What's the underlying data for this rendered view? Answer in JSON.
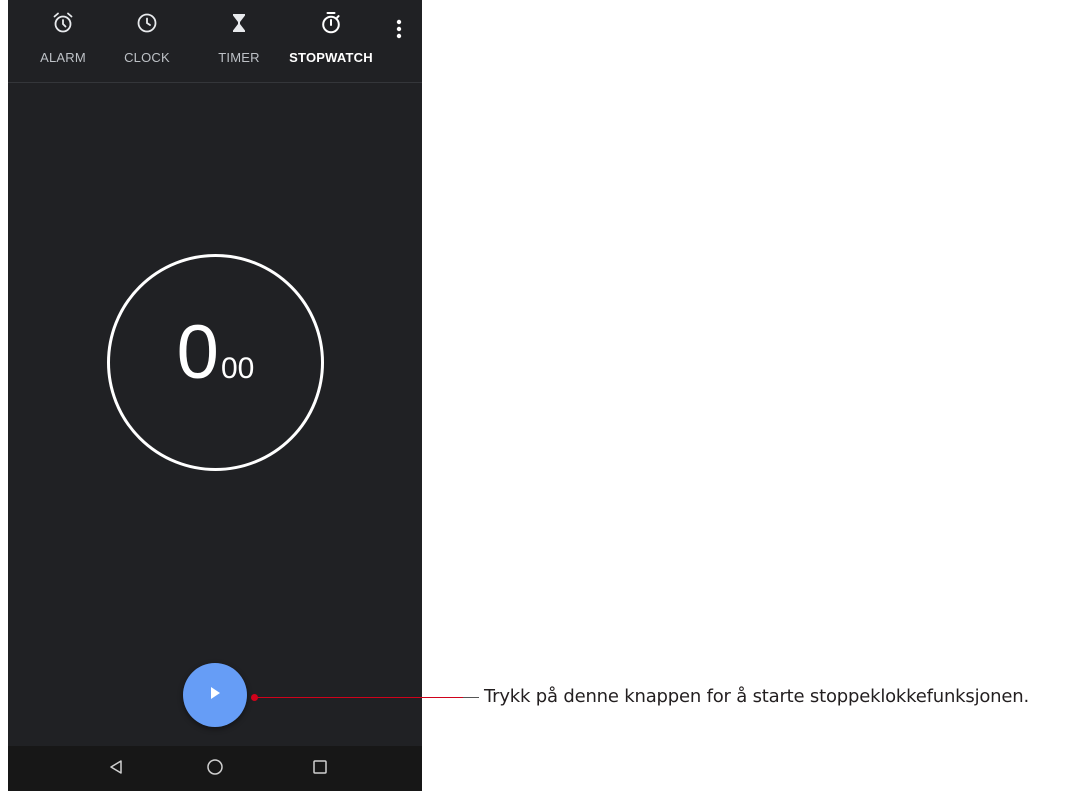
{
  "tabs": [
    {
      "label": "ALARM",
      "icon": "alarm-clock-icon",
      "active": false
    },
    {
      "label": "CLOCK",
      "icon": "clock-icon",
      "active": false
    },
    {
      "label": "TIMER",
      "icon": "hourglass-icon",
      "active": false
    },
    {
      "label": "STOPWATCH",
      "icon": "stopwatch-icon",
      "active": true
    }
  ],
  "overflow_menu": {
    "icon": "more-vertical-icon"
  },
  "stopwatch": {
    "seconds": "0",
    "hundredths": "00"
  },
  "play_button": {
    "icon": "play-icon",
    "color": "#669df6"
  },
  "navbar": {
    "back_icon": "back-triangle-icon",
    "home_icon": "home-circle-icon",
    "recent_icon": "recent-square-icon"
  },
  "annotation": {
    "text": "Trykk på denne knappen for å starte stoppeklokkefunksjonen.",
    "line_color": "#d0021b"
  },
  "colors": {
    "background": "#202124",
    "navbar": "#171717",
    "accent": "#669df6"
  }
}
